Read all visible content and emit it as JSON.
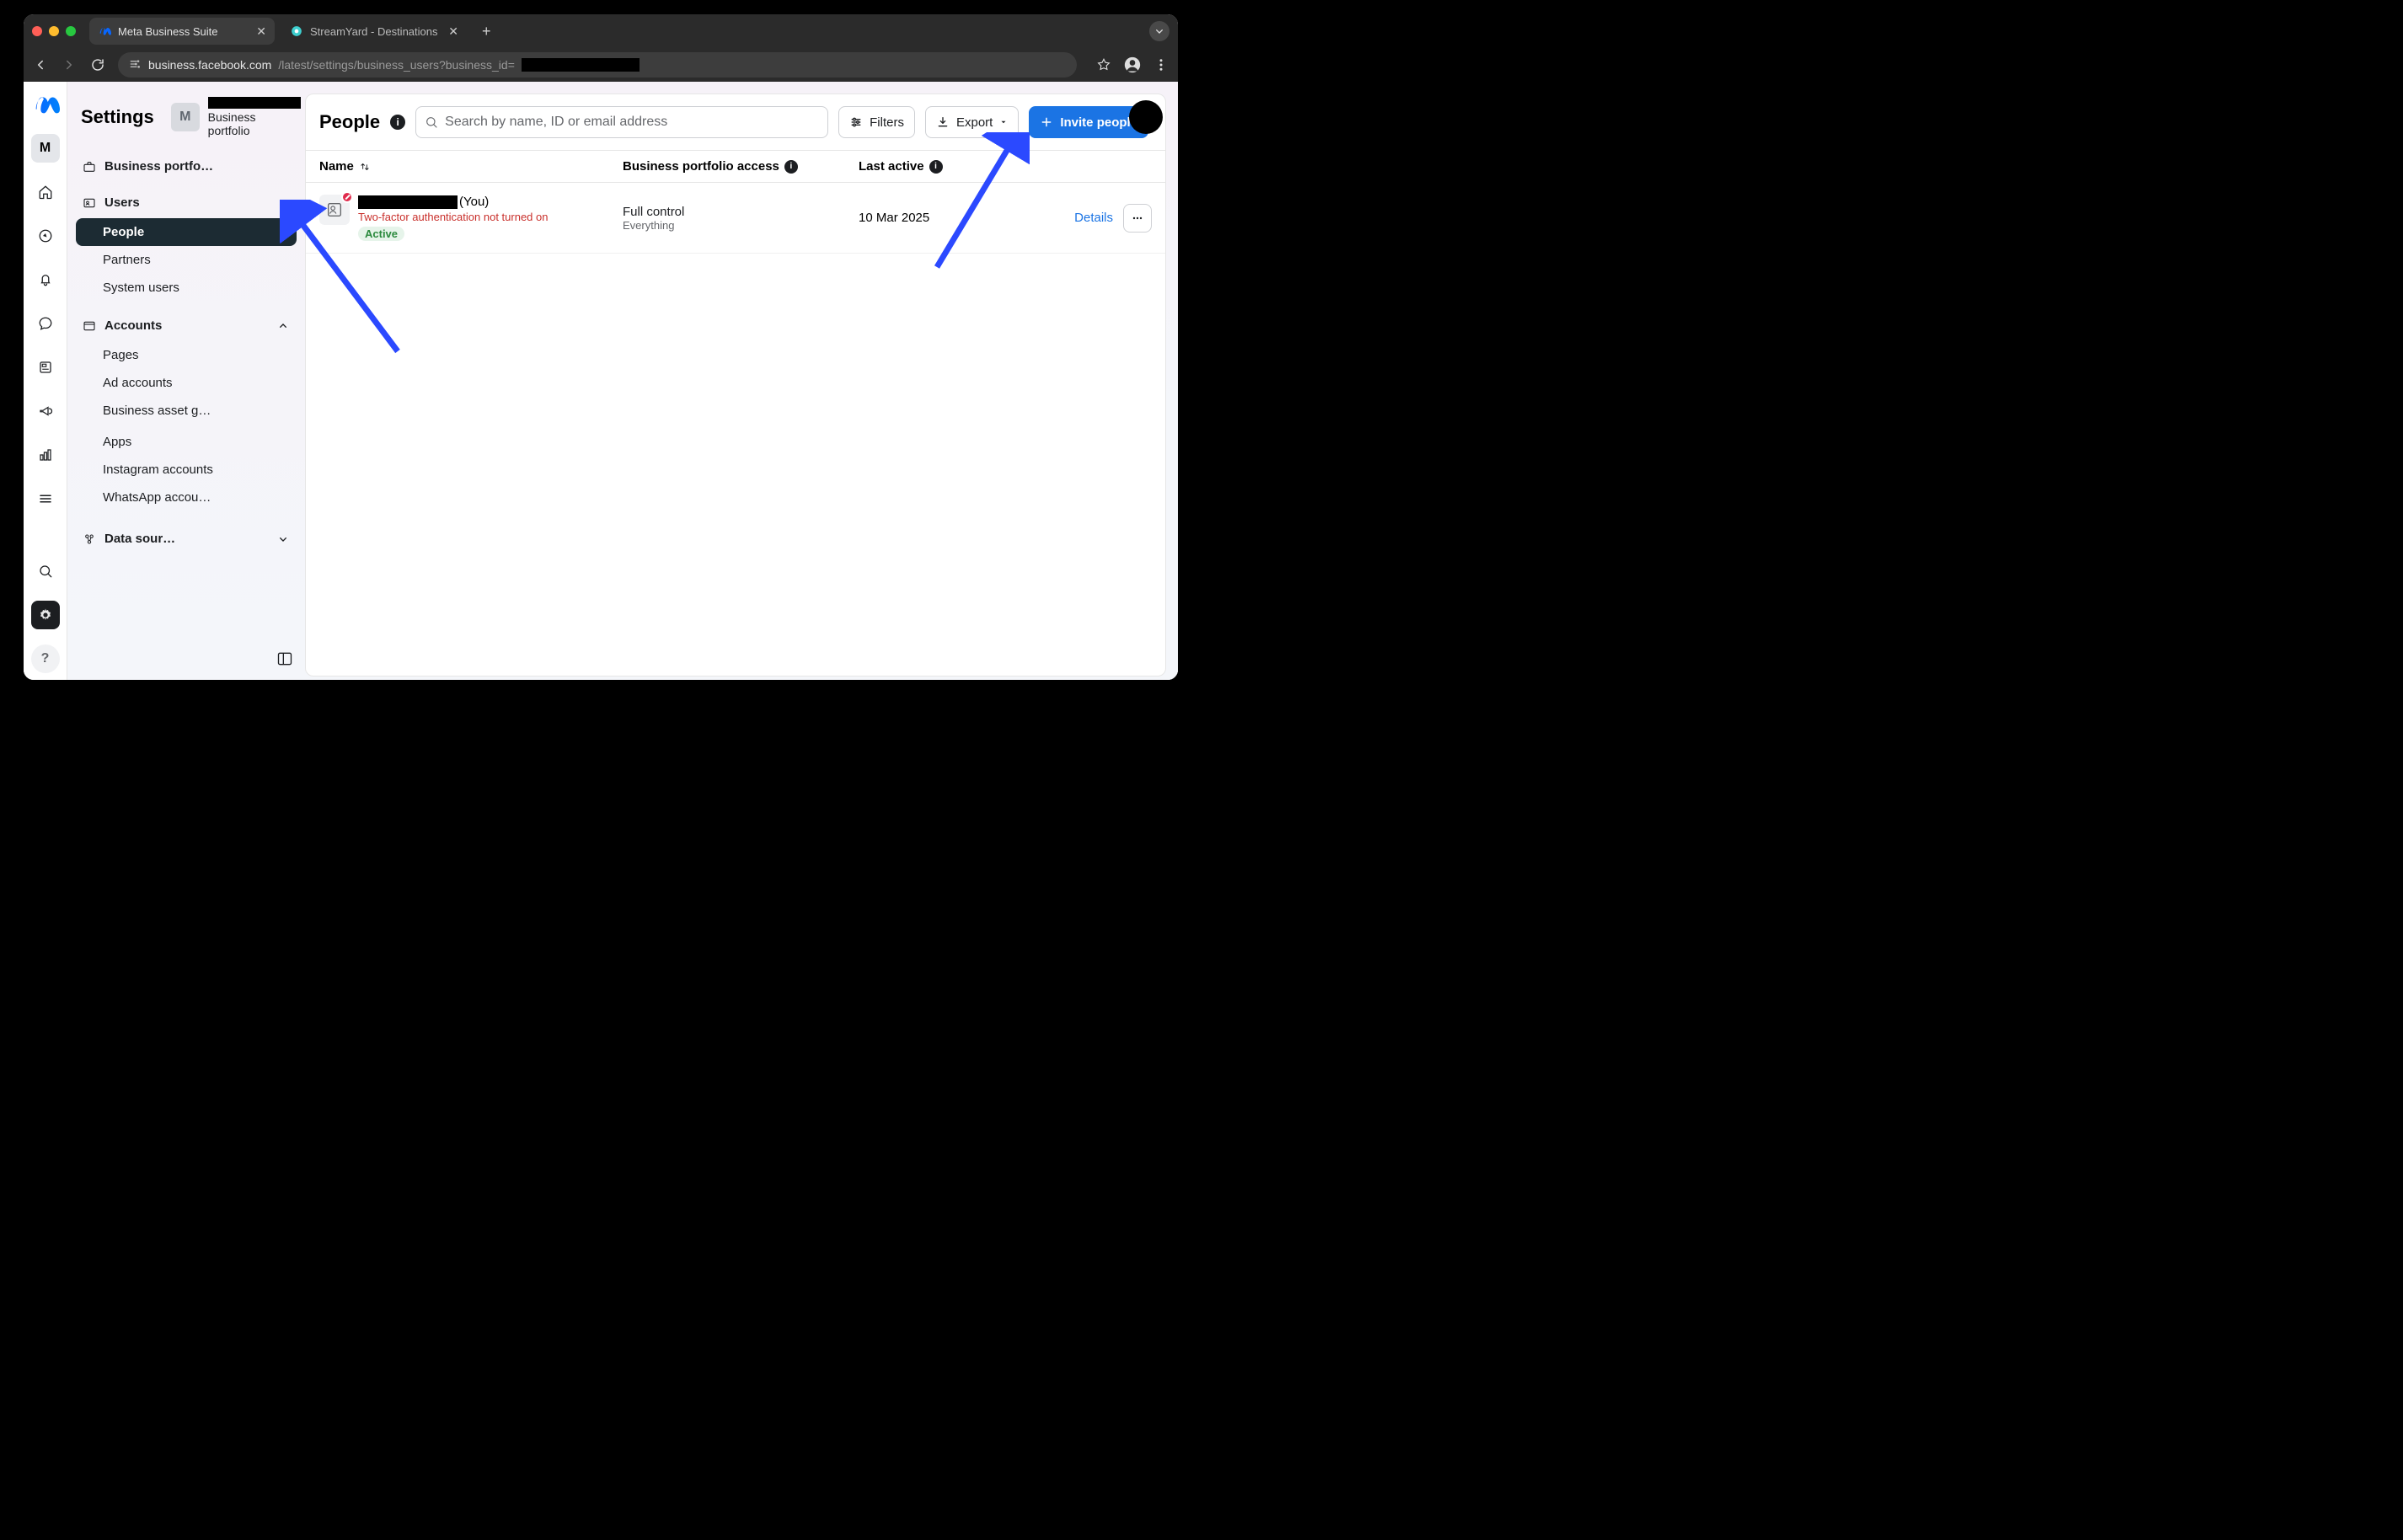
{
  "browser": {
    "tabs": [
      {
        "title": "Meta Business Suite",
        "active": true
      },
      {
        "title": "StreamYard - Destinations",
        "active": false
      }
    ],
    "url_prefix": "business.facebook.com",
    "url_suffix": "/latest/settings/business_users?business_id="
  },
  "header": {
    "title": "Settings",
    "portfolio_badge": "M",
    "portfolio_label": "Business portfolio"
  },
  "rail": {
    "badge": "M"
  },
  "sidebar": {
    "portfolio_item": "Business portfo…",
    "users": {
      "label": "Users",
      "items": [
        "People",
        "Partners",
        "System users"
      ],
      "active_index": 0
    },
    "accounts": {
      "label": "Accounts",
      "items": [
        "Pages",
        "Ad accounts",
        "Business asset gr…",
        "Apps",
        "Instagram accounts",
        "WhatsApp accou…"
      ]
    },
    "datasources": {
      "label": "Data sour…"
    }
  },
  "main": {
    "title": "People",
    "search_placeholder": "Search by name, ID or email address",
    "filters_label": "Filters",
    "export_label": "Export",
    "invite_label": "Invite people",
    "columns": {
      "name": "Name",
      "access": "Business portfolio access",
      "last": "Last active"
    },
    "row": {
      "you_suffix": "(You)",
      "warning": "Two-factor authentication not turned on",
      "status_pill": "Active",
      "access_title": "Full control",
      "access_sub": "Everything",
      "last_active": "10 Mar 2025",
      "details": "Details"
    }
  }
}
